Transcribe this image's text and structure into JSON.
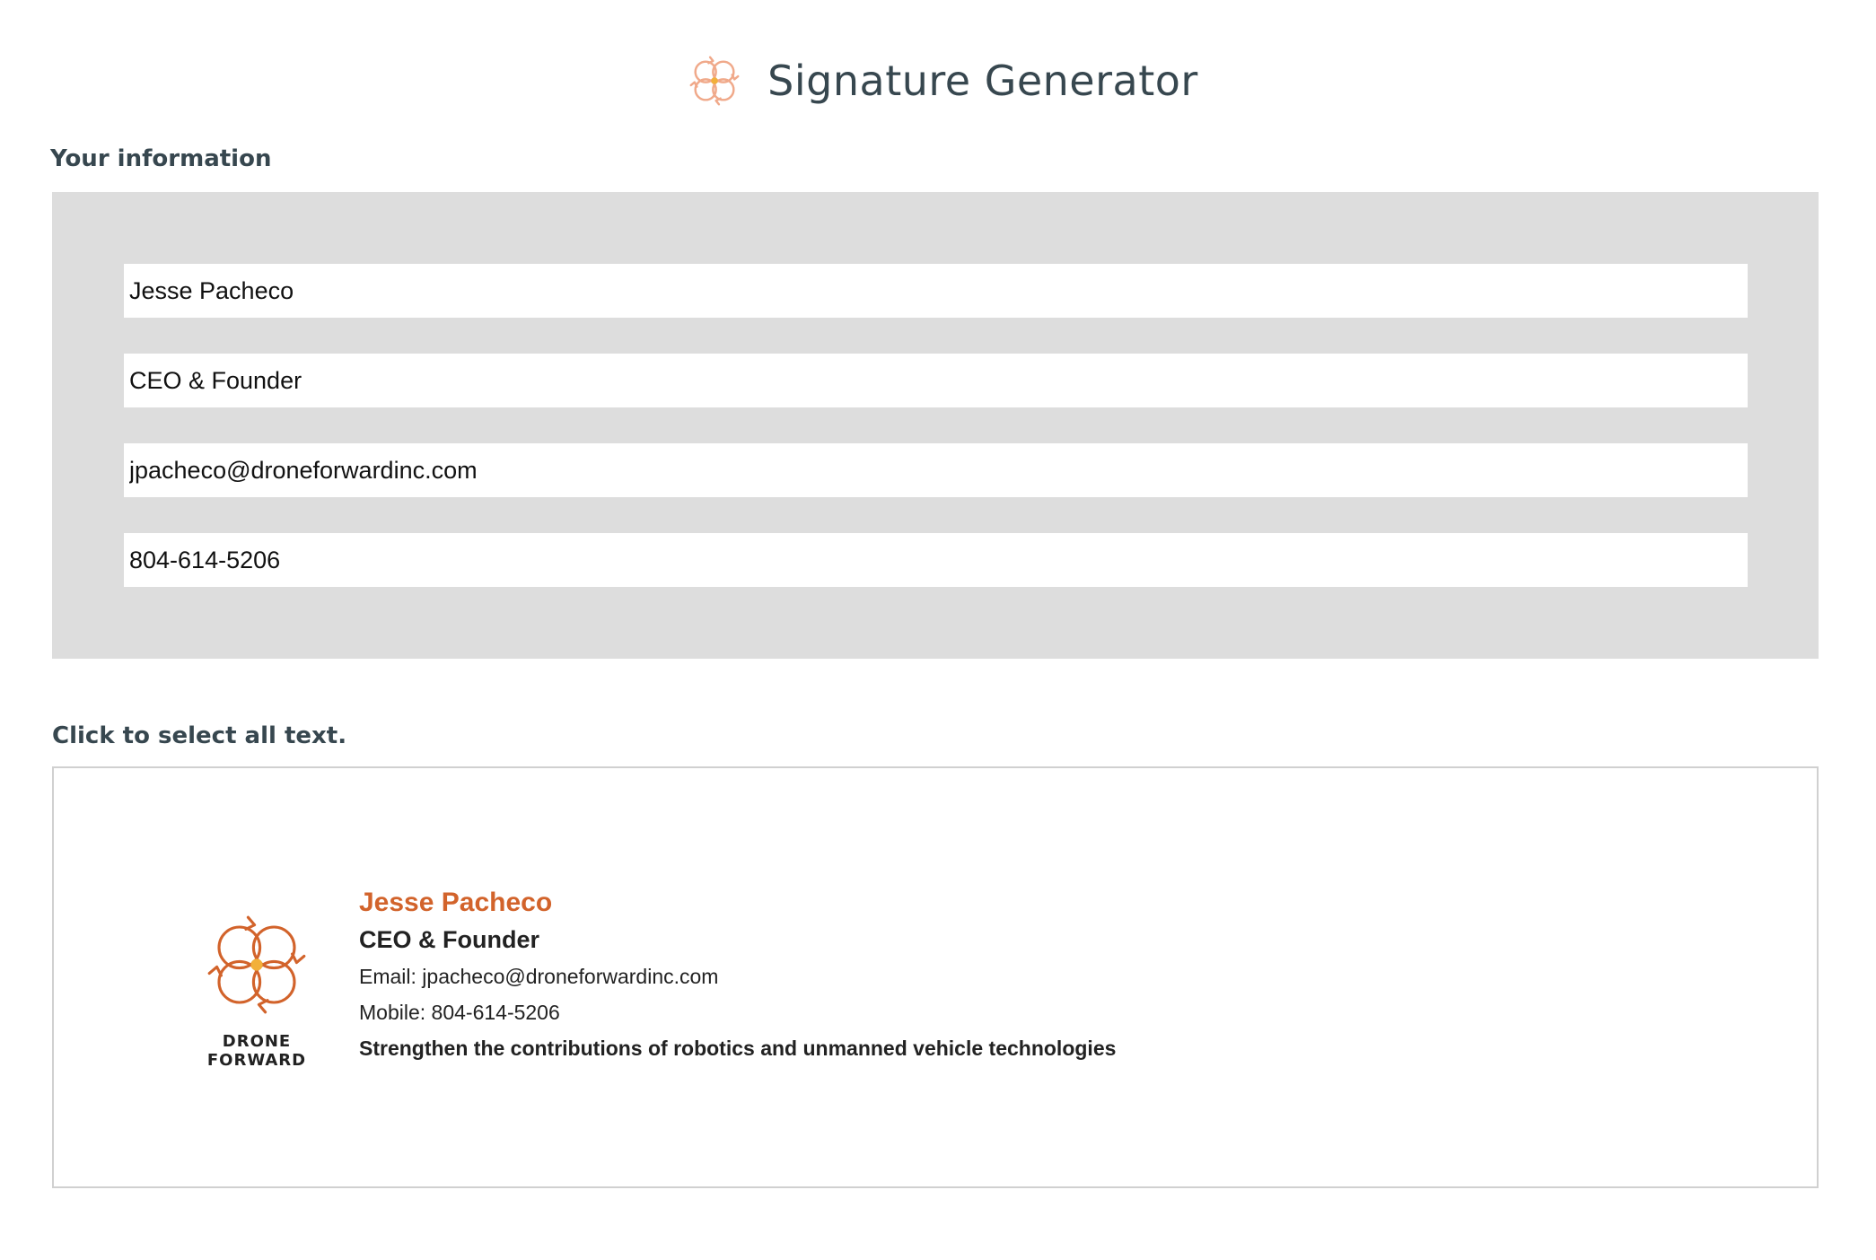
{
  "header": {
    "title": "Signature Generator",
    "logo_icon": "drone-rotors-icon"
  },
  "form": {
    "heading": "Your information",
    "name_value": "Jesse Pacheco",
    "title_value": "CEO & Founder",
    "email_value": "jpacheco@droneforwardinc.com",
    "phone_value": "804-614-5206"
  },
  "preview": {
    "heading": "Click to select all text.",
    "brand_name": "DRONE FORWARD",
    "name": "Jesse Pacheco",
    "title": "CEO & Founder",
    "email_line": "Email: jpacheco@droneforwardinc.com",
    "mobile_line": "Mobile: 804-614-5206",
    "tagline": "Strengthen the contributions of robotics and unmanned vehicle technologies"
  },
  "colors": {
    "accent": "#d2632b",
    "accent_light": "#f0a98a",
    "text_dark": "#37474f",
    "panel_bg": "#dddddd",
    "hub": "#f2b03a"
  }
}
